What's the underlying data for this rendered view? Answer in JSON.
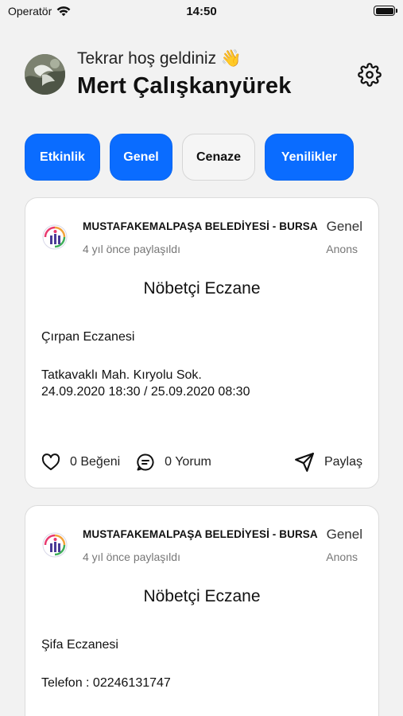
{
  "status_bar": {
    "carrier": "Operatör",
    "time": "14:50",
    "battery_level": 1.0
  },
  "header": {
    "greeting": "Tekrar hoş geldiniz 👋",
    "user_name": "Mert Çalışkanyürek"
  },
  "tabs": [
    {
      "label": "Etkinlik",
      "active": true
    },
    {
      "label": "Genel",
      "active": true
    },
    {
      "label": "Cenaze",
      "active": false
    },
    {
      "label": "Yenilikler",
      "active": true
    }
  ],
  "posts": [
    {
      "org_name": "MUSTAFAKEMALPAŞA BELEDİYESİ - BURSA",
      "category": "Genel",
      "posted_time": "4 yıl önce paylaşıldı",
      "type": "Anons",
      "title": "Nöbetçi Eczane",
      "pharmacy": "Çırpan Eczanesi",
      "details": "Tatkavaklı Mah. Kıryolu Sok.\n24.09.2020 18:30 / 25.09.2020 08:30",
      "likes_label": "0 Beğeni",
      "comments_label": "0 Yorum",
      "share_label": "Paylaş"
    },
    {
      "org_name": "MUSTAFAKEMALPAŞA BELEDİYESİ - BURSA",
      "category": "Genel",
      "posted_time": "4 yıl önce paylaşıldı",
      "type": "Anons",
      "title": "Nöbetçi Eczane",
      "pharmacy": "Şifa Eczanesi",
      "details": "Telefon : 02246131747"
    }
  ],
  "colors": {
    "accent": "#0a6cff",
    "background": "#f2f2f2",
    "card": "#ffffff",
    "muted_text": "#777777"
  }
}
